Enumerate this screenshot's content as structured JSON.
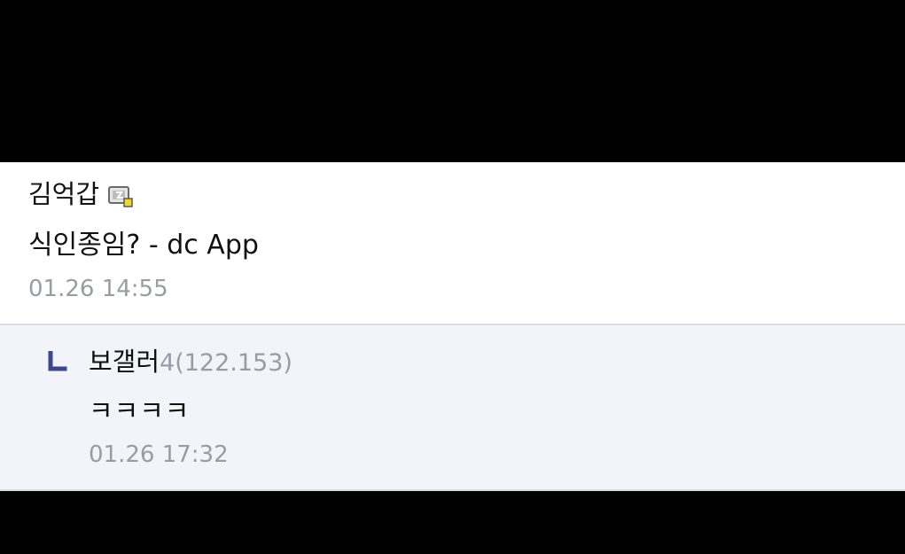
{
  "comment": {
    "nickname": "김억갑",
    "gallog_icon": "fixed-nick-icon",
    "text": "식인종임? - dc App",
    "date": "01.26 14:55"
  },
  "reply": {
    "indicator_icon": "reply-arrow-icon",
    "nickname": "보갤러",
    "ip": "4(122.153)",
    "text": "ㅋㅋㅋㅋ",
    "date": "01.26 17:32"
  },
  "colors": {
    "background_bars": "#000000",
    "comment_bg": "#ffffff",
    "reply_bg": "#f3f4f9",
    "text": "#111111",
    "muted": "#9a9ca3",
    "reply_arrow": "#3b4890",
    "icon_badge": "#f5d61c"
  }
}
